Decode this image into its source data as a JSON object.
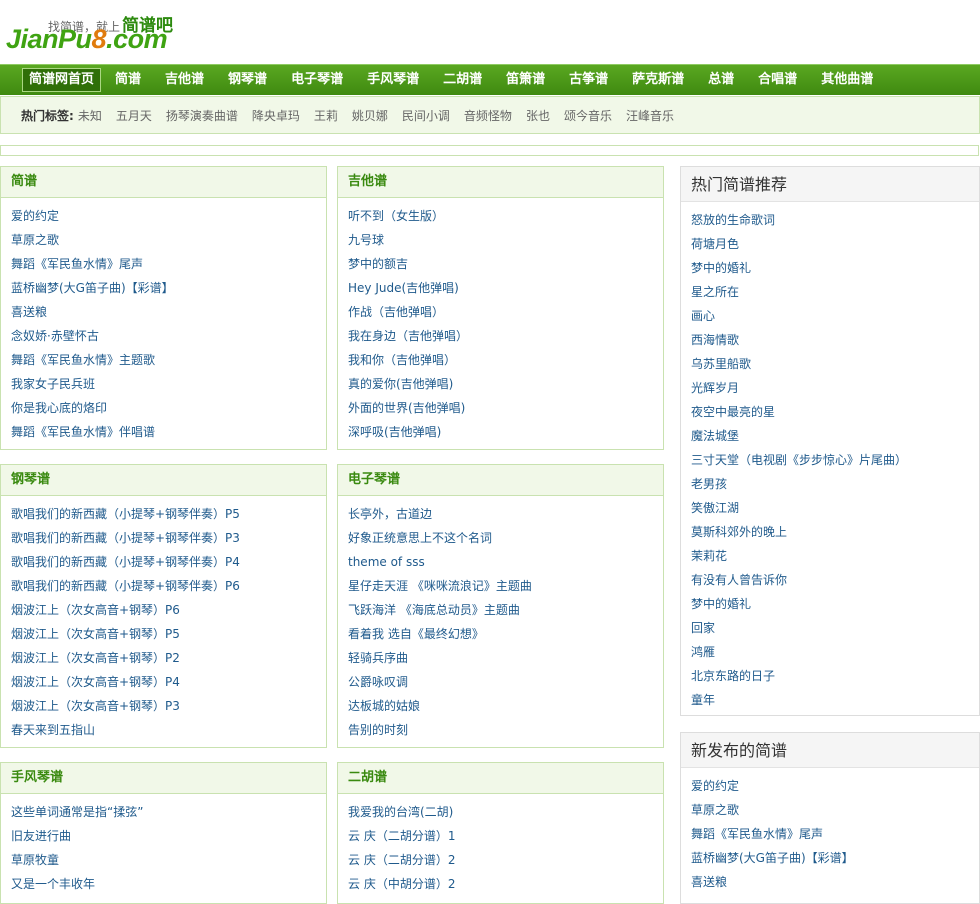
{
  "logo": {
    "slogan_prefix": "找简谱，就上",
    "slogan_strong": "简谱吧",
    "brand_left": "JianPu",
    "brand_eight": "8",
    "brand_right": ".com"
  },
  "nav": {
    "items": [
      "简谱网首页",
      "简谱",
      "吉他谱",
      "钢琴谱",
      "电子琴谱",
      "手风琴谱",
      "二胡谱",
      "笛箫谱",
      "古筝谱",
      "萨克斯谱",
      "总谱",
      "合唱谱",
      "其他曲谱"
    ]
  },
  "tags": {
    "title": "热门标签:",
    "items": [
      "未知",
      "五月天",
      "扬琴演奏曲谱",
      "降央卓玛",
      "王莉",
      "姚贝娜",
      "民间小调",
      "音频怪物",
      "张也",
      "颂今音乐",
      "汪峰音乐"
    ]
  },
  "sections": [
    {
      "title": "简谱",
      "items": [
        "爱的约定",
        "草原之歌",
        "舞蹈《军民鱼水情》尾声",
        "蓝桥幽梦(大G笛子曲)【彩谱】",
        "喜送粮",
        "念奴娇·赤壁怀古",
        "舞蹈《军民鱼水情》主题歌",
        "我家女子民兵班",
        "你是我心底的烙印",
        "舞蹈《军民鱼水情》伴唱谱"
      ]
    },
    {
      "title": "吉他谱",
      "items": [
        "听不到（女生版）",
        "九号球",
        "梦中的额吉",
        "Hey Jude(吉他弹唱)",
        "作战（吉他弹唱）",
        "我在身边（吉他弹唱）",
        "我和你（吉他弹唱）",
        "真的爱你(吉他弹唱)",
        "外面的世界(吉他弹唱)",
        "深呼吸(吉他弹唱)"
      ]
    },
    {
      "title": "钢琴谱",
      "items": [
        "歌唱我们的新西藏（小提琴+钢琴伴奏）P5",
        "歌唱我们的新西藏（小提琴+钢琴伴奏）P3",
        "歌唱我们的新西藏（小提琴+钢琴伴奏）P4",
        "歌唱我们的新西藏（小提琴+钢琴伴奏）P6",
        "烟波江上（次女高音+钢琴）P6",
        "烟波江上（次女高音+钢琴）P5",
        "烟波江上（次女高音+钢琴）P2",
        "烟波江上（次女高音+钢琴）P4",
        "烟波江上（次女高音+钢琴）P3",
        "春天来到五指山"
      ]
    },
    {
      "title": "电子琴谱",
      "items": [
        "长亭外，古道边",
        "好象正统意思上不这个名词",
        "theme of sss",
        "星仔走天涯 《咪咪流浪记》主题曲",
        "飞跃海洋 《海底总动员》主题曲",
        "看着我 选自《最终幻想》",
        "轻骑兵序曲",
        "公爵咏叹调",
        "达板城的姑娘",
        "告别的时刻"
      ]
    },
    {
      "title": "手风琴谱",
      "items": [
        "这些单词通常是指“揉弦”",
        "旧友进行曲",
        "草原牧童",
        "又是一个丰收年"
      ]
    },
    {
      "title": "二胡谱",
      "items": [
        "我爱我的台湾(二胡)",
        "云 庆（二胡分谱）1",
        "云 庆（二胡分谱）2",
        "云 庆（中胡分谱）2"
      ]
    }
  ],
  "sidebar": {
    "hot": {
      "title": "热门简谱推荐",
      "items": [
        "怒放的生命歌词",
        "荷塘月色",
        "梦中的婚礼",
        "星之所在",
        "画心",
        "西海情歌",
        "乌苏里船歌",
        "光辉岁月",
        "夜空中最亮的星",
        "魔法城堡",
        "三寸天堂（电视剧《步步惊心》片尾曲）",
        "老男孩",
        "笑傲江湖",
        "莫斯科郊外的晚上",
        "茉莉花",
        "有没有人曾告诉你",
        "梦中的婚礼",
        "回家",
        "鸿雁",
        "北京东路的日子",
        "童年"
      ]
    },
    "new": {
      "title": "新发布的简谱",
      "items": [
        "爱的约定",
        "草原之歌",
        "舞蹈《军民鱼水情》尾声",
        "蓝桥幽梦(大G笛子曲)【彩谱】",
        "喜送粮"
      ]
    }
  },
  "colors": {
    "nav_green": "#4a9818",
    "accent_green": "#3a8a10",
    "link_blue": "#1f5a8c",
    "panel_bg": "#f1f8e8"
  }
}
